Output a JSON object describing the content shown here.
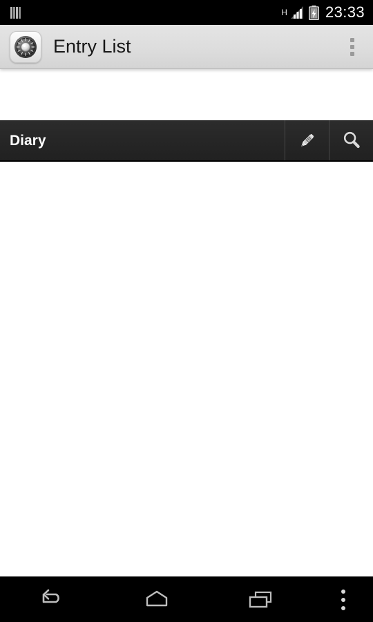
{
  "status_bar": {
    "notification_icon": "bars-icon",
    "network_type": "H",
    "signal_icon": "signal-bars-icon",
    "battery_icon": "battery-charging-icon",
    "time": "23:33"
  },
  "action_bar": {
    "app_icon": "safe-dial-icon",
    "title": "Entry List",
    "overflow_icon": "overflow-menu-icon"
  },
  "section_bar": {
    "title": "Diary",
    "edit_icon": "pencil-icon",
    "edit_label": "New Entry",
    "search_icon": "search-icon",
    "search_label": "Search"
  },
  "content": {
    "empty": true,
    "empty_text": ""
  },
  "nav_bar": {
    "back_icon": "back-arrow-icon",
    "back_label": "Back",
    "home_icon": "home-icon",
    "home_label": "Home",
    "recents_icon": "recents-icon",
    "recents_label": "Recent apps",
    "menu_icon": "overflow-menu-icon",
    "menu_label": "Menu"
  },
  "colors": {
    "status_bar_bg": "#000000",
    "action_bar_bg": "#dddddd",
    "section_bar_bg": "#262626",
    "content_bg": "#ffffff",
    "nav_bar_bg": "#000000",
    "icon_gray": "#b4b4b4",
    "title_text": "#171717",
    "section_text": "#ffffff"
  }
}
